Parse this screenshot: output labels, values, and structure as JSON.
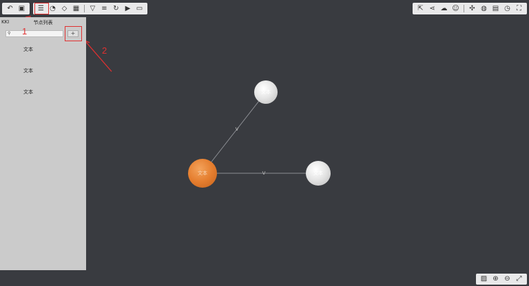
{
  "toolbar_left1": {
    "icons": [
      "undo-icon",
      "save-icon"
    ]
  },
  "toolbar_left2": {
    "icons": [
      "list-icon",
      "clock-icon",
      "tag-icon",
      "table-icon",
      "filter-icon",
      "search-list-icon",
      "refresh-icon",
      "play-icon",
      "slideshow-icon"
    ]
  },
  "toolbar_right": {
    "icons": [
      "export-icon",
      "share-icon",
      "cloud-icon",
      "users-icon",
      "fit-icon",
      "globe-icon",
      "notes-icon",
      "history-icon",
      "fullscreen-icon"
    ]
  },
  "toolbar_bottom": {
    "icons": [
      "edit-icon",
      "zoom-in-icon",
      "zoom-out-icon",
      "expand-icon"
    ]
  },
  "sidebar": {
    "collapse_label": "KKI",
    "title": "节点列表",
    "search_placeholder": "",
    "add_label": "+",
    "items": [
      "文本",
      "文本",
      "文本"
    ]
  },
  "annotations": {
    "one": "1",
    "two": "2"
  },
  "graph": {
    "nodes": [
      {
        "label": "文本",
        "color": "#e57e2f"
      },
      {
        "label": "文本",
        "color": "#e6e6e6"
      },
      {
        "label": "文本",
        "color": "#e6e6e6"
      }
    ],
    "edges": [
      {
        "label": "V"
      },
      {
        "label": "V"
      }
    ]
  }
}
